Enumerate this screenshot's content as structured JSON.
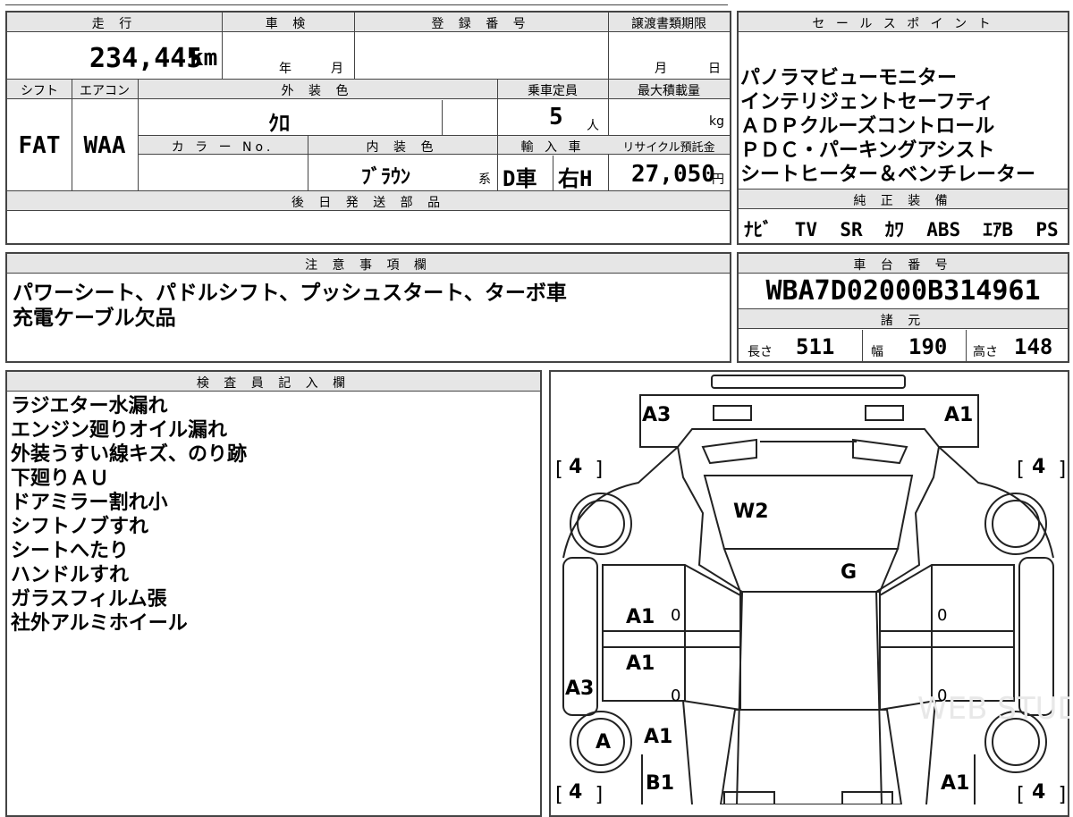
{
  "header": {
    "mileage_label": "走 行",
    "mileage_value": "234,445",
    "mileage_unit": "km",
    "inspection_label": "車 検",
    "inspection_year": "年",
    "inspection_month": "月",
    "registration_label": "登 録 番 号",
    "transfer_deadline_label": "譲渡書類期限",
    "transfer_month": "月",
    "transfer_day": "日"
  },
  "specs": {
    "shift_label": "シフト",
    "shift_value": "FAT",
    "aircon_label": "エアコン",
    "aircon_value": "WAA",
    "exterior_color_label": "外 装 色",
    "exterior_color_value": "ｸﾛ",
    "capacity_label": "乗車定員",
    "capacity_value": "5",
    "capacity_unit": "人",
    "max_load_label": "最大積載量",
    "max_load_unit": "kg",
    "color_no_label": "カ ラ ー No.",
    "interior_color_label": "内 装 色",
    "interior_color_value": "ﾌﾞﾗｳﾝ",
    "interior_suffix": "系",
    "import_label": "輸 入 車",
    "import_value": "D車",
    "handle_value": "右H",
    "recycle_label": "リサイクル預託金",
    "recycle_value": "27,050",
    "recycle_unit": "円"
  },
  "later_parts": {
    "label": "後 日 発 送 部 品"
  },
  "sales_points": {
    "label": "セ ー ル ス ポ イ ン ト",
    "items": [
      "パノラマビューモニター",
      "インテリジェントセーフティ",
      "ＡＤＰクルーズコントロール",
      "ＰＤＣ・パーキングアシスト",
      "シートヒーター＆ベンチレーター"
    ]
  },
  "equipment": {
    "label": "純 正 装 備",
    "value": "ﾅﾋﾞ  TV  SR  ｶﾜ  ABS  ｴｱB  PS  PW"
  },
  "notes": {
    "label": "注 意 事 項 欄",
    "lines": [
      "パワーシート、パドルシフト、プッシュスタート、ターボ車",
      "充電ケーブル欠品"
    ]
  },
  "chassis": {
    "label": "車 台 番 号",
    "value": "WBA7D02000B314961"
  },
  "dimensions": {
    "label": "諸 元",
    "length_label": "長さ",
    "length_value": "511",
    "width_label": "幅",
    "width_value": "190",
    "height_label": "高さ",
    "height_value": "148"
  },
  "inspector": {
    "label": "検 査 員 記 入 欄",
    "lines": [
      "ラジエター水漏れ",
      "エンジン廻りオイル漏れ",
      "外装うすい線キズ、のり跡",
      "下廻りＡＵ",
      "ドアミラー割れ小",
      "シフトノブすれ",
      "シートへたり",
      "ハンドルすれ",
      "ガラスフィルム張",
      "社外アルミホイール"
    ]
  },
  "diagram": {
    "marks": {
      "front_left_corner": "A3",
      "front_right_corner": "A1",
      "windshield": "W2",
      "roof": "G",
      "left_front_door": "A1",
      "left_rear_door": "A1",
      "left_sill": "A3",
      "left_rear_wheel": "A",
      "left_rear_fender": "A1",
      "left_rear_corner": "B1",
      "right_rear_corner": "A1",
      "zero_mark": "0"
    },
    "tire_depth": "4",
    "watermark": "WEB STUDIO PRO"
  },
  "colors": {
    "border": "#444444",
    "header_bg": "#e6e6e6"
  }
}
